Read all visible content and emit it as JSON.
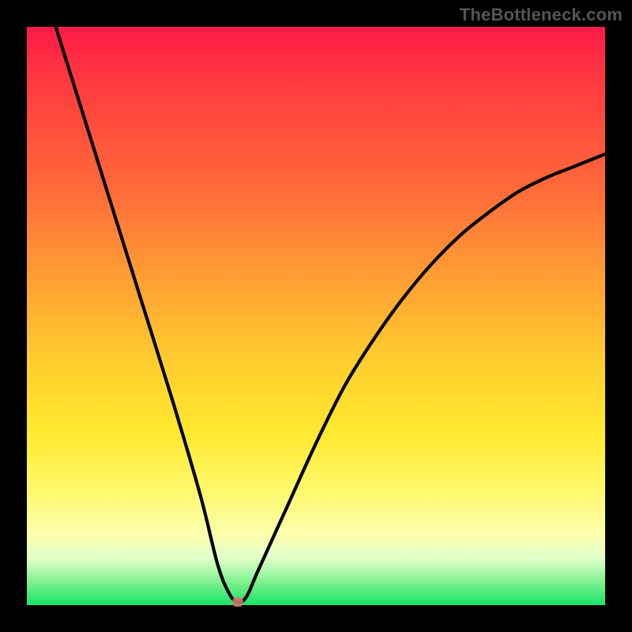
{
  "watermark": "TheBottleneck.com",
  "colors": {
    "frame": "#000000",
    "gradient_top": "#ff1a48",
    "gradient_bottom": "#17e36a",
    "curve_stroke": "#000000",
    "marker": "#c97c6a"
  },
  "chart_data": {
    "type": "line",
    "title": "",
    "xlabel": "",
    "ylabel": "",
    "xlim": [
      0,
      100
    ],
    "ylim": [
      0,
      100
    ],
    "grid": false,
    "legend": false,
    "series": [
      {
        "name": "bottleneck-curve",
        "x": [
          5,
          10,
          15,
          20,
          25,
          30,
          33,
          35,
          36.5,
          38,
          40,
          45,
          50,
          55,
          60,
          65,
          70,
          75,
          80,
          85,
          90,
          95,
          100
        ],
        "values": [
          100,
          84,
          68,
          52,
          36,
          19,
          7,
          2,
          0.5,
          1.5,
          6,
          17,
          28,
          38,
          46,
          53,
          59,
          64,
          68,
          71.5,
          74,
          76,
          78
        ]
      }
    ],
    "annotations": [
      {
        "name": "minimum-marker",
        "x": 36.5,
        "y": 0.5
      }
    ]
  }
}
